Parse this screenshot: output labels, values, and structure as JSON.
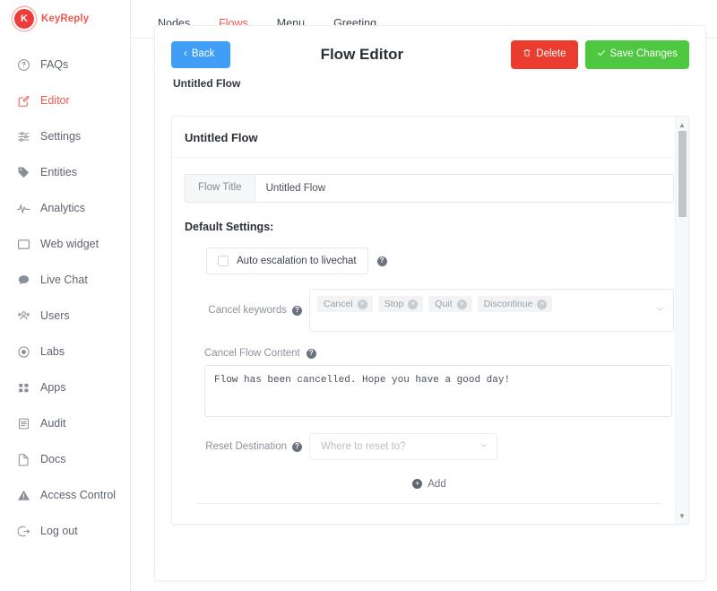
{
  "brand": {
    "name": "KeyReply",
    "mark": "K",
    "accent": "#f1594e"
  },
  "sidebar": {
    "items": [
      {
        "label": "FAQs",
        "icon": "question-circle-icon",
        "active": false
      },
      {
        "label": "Editor",
        "icon": "edit-square-icon",
        "active": true
      },
      {
        "label": "Settings",
        "icon": "sliders-icon",
        "active": false
      },
      {
        "label": "Entities",
        "icon": "tag-icon",
        "active": false
      },
      {
        "label": "Analytics",
        "icon": "pulse-icon",
        "active": false
      },
      {
        "label": "Web widget",
        "icon": "window-icon",
        "active": false
      },
      {
        "label": "Live Chat",
        "icon": "chat-bubble-icon",
        "active": false
      },
      {
        "label": "Users",
        "icon": "users-icon",
        "active": false
      },
      {
        "label": "Labs",
        "icon": "radio-dot-icon",
        "active": false
      },
      {
        "label": "Apps",
        "icon": "grid-icon",
        "active": false
      },
      {
        "label": "Audit",
        "icon": "list-document-icon",
        "active": false
      },
      {
        "label": "Docs",
        "icon": "file-icon",
        "active": false
      },
      {
        "label": "Access Control",
        "icon": "warning-triangle-icon",
        "active": false
      },
      {
        "label": "Log out",
        "icon": "logout-icon",
        "active": false
      }
    ]
  },
  "tabs": [
    {
      "label": "Nodes",
      "active": false
    },
    {
      "label": "Flows",
      "active": true
    },
    {
      "label": "Menu",
      "active": false
    },
    {
      "label": "Greeting",
      "active": false
    }
  ],
  "editor": {
    "back_label": "Back",
    "title": "Flow Editor",
    "delete_label": "Delete",
    "save_label": "Save Changes",
    "breadcrumb": "Untitled Flow",
    "colors": {
      "back": "#409ef7",
      "delete": "#ea3d2f",
      "save": "#4ec840"
    }
  },
  "panel": {
    "title": "Untitled Flow",
    "flow_title_addon": "Flow Title",
    "flow_title_value": "Untitled Flow",
    "flow_title_placeholder": "Flow Title",
    "section_title": "Default Settings:",
    "auto_escalation_label": "Auto escalation to livechat",
    "auto_escalation_checked": false,
    "cancel_keywords_label": "Cancel keywords",
    "cancel_keywords": [
      "Cancel",
      "Stop",
      "Quit",
      "Discontinue"
    ],
    "cancel_flow_content_label": "Cancel Flow Content",
    "cancel_flow_content_value": "Flow has been cancelled. Hope you have a good day!",
    "cancel_flow_content_placeholder": "Cancel Flow Content",
    "reset_destination_label": "Reset Destination",
    "reset_destination_placeholder": "Where to reset to?",
    "reset_destination_value": "",
    "add_label": "Add",
    "help_glyph": "?",
    "tag_remove_glyph": "×",
    "caret_glyph": "⌄",
    "plus_glyph": "+"
  }
}
